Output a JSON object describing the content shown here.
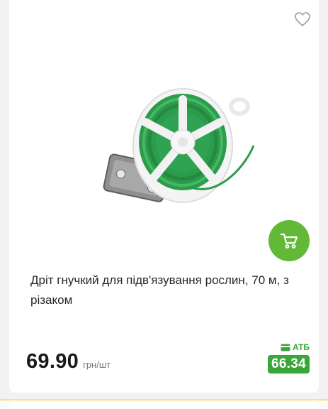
{
  "product": {
    "title": "Дріт гнучкий для підв'язування рослин, 70 м, з різаком",
    "price": "69.90",
    "unit": "грн/шт",
    "atb_label": "АТБ",
    "atb_price": "66.34"
  },
  "colors": {
    "accent_green": "#62b837",
    "atb_green": "#3aa53a",
    "text": "#262626"
  },
  "icons": {
    "favorite": "heart-icon",
    "cart": "cart-icon",
    "atb_card": "card-icon"
  }
}
